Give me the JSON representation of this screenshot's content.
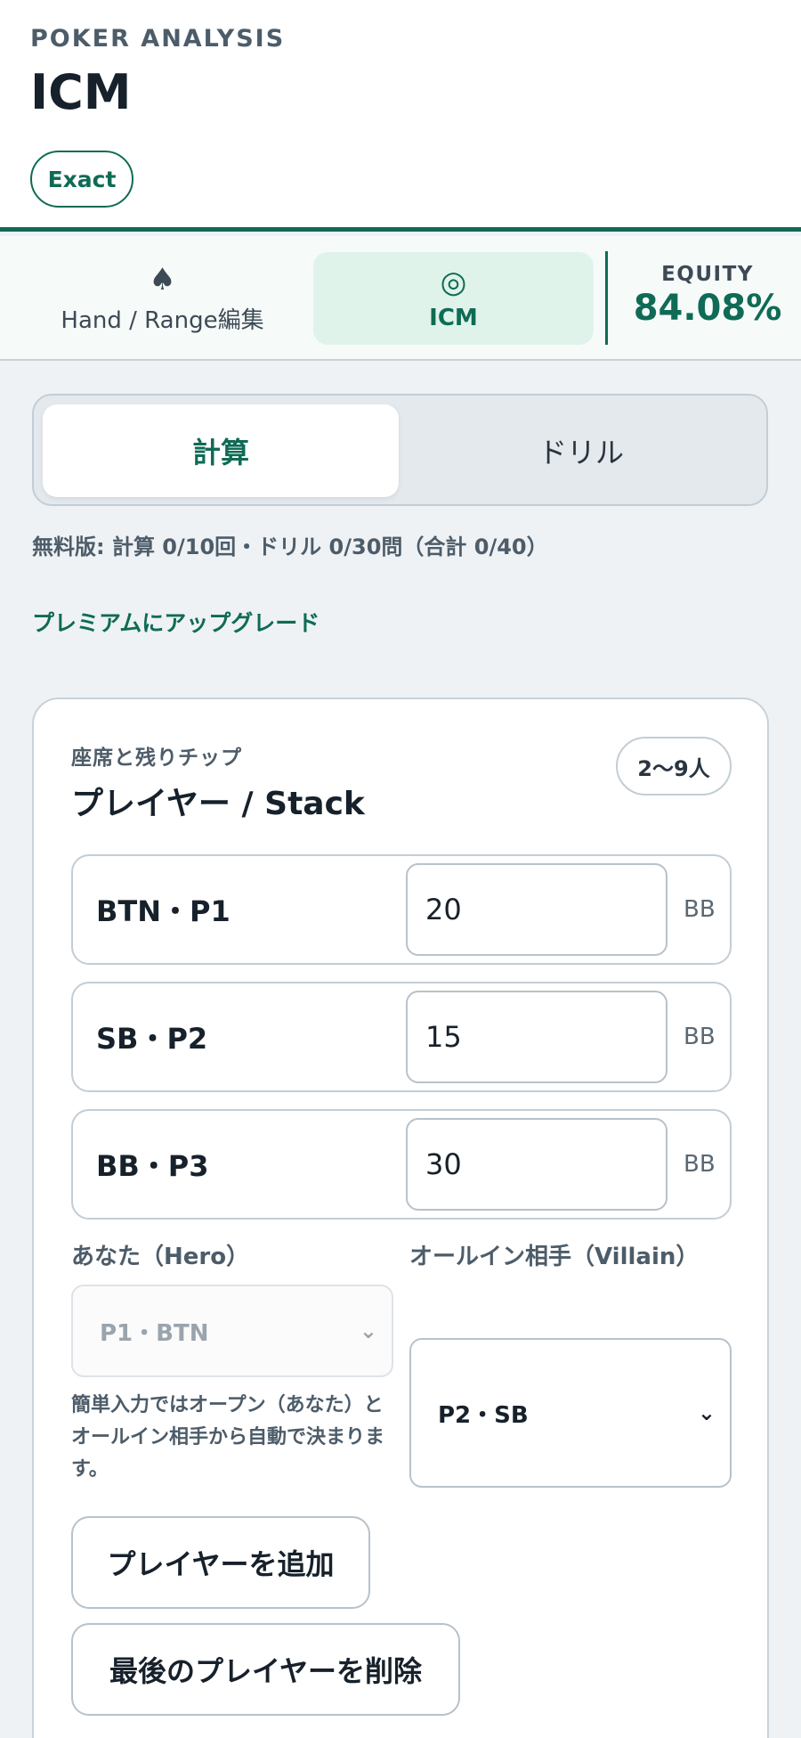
{
  "header": {
    "kicker": "POKER ANALYSIS",
    "title": "ICM",
    "badge": "Exact"
  },
  "tabs": [
    {
      "icon": "spade-icon",
      "glyph": "♠",
      "label": "Hand / Range編集",
      "active": false
    },
    {
      "icon": "target-icon",
      "glyph": "◎",
      "label": "ICM",
      "active": true
    }
  ],
  "equity": {
    "label": "EQUITY",
    "value": "84.08%"
  },
  "mode_switch": {
    "calc_label": "計算",
    "drill_label": "ドリル",
    "selected": "計算"
  },
  "free_note": "無料版: 計算 0/10回・ドリル 0/30問（合計 0/40）",
  "upgrade_link": "プレミアムにアップグレード",
  "players_card": {
    "subtitle": "座席と残りチップ",
    "title": "プレイヤー / Stack",
    "count_badge": "2〜9人",
    "rows": [
      {
        "name": "BTN・P1",
        "stack": "20",
        "unit": "BB"
      },
      {
        "name": "SB・P2",
        "stack": "15",
        "unit": "BB"
      },
      {
        "name": "BB・P3",
        "stack": "30",
        "unit": "BB"
      }
    ],
    "hero_label": "あなた（Hero）",
    "hero_value": "P1・BTN",
    "villain_label": "オールイン相手（Villain）",
    "villain_value": "P2・SB",
    "help_text": "簡単入力ではオープン（あなた）とオールイン相手から自動で決まります。",
    "add_button": "プレイヤーを追加",
    "remove_button": "最後のプレイヤーを削除"
  },
  "colors": {
    "accent": "#0f6b55",
    "accent_soft": "#dff3ea",
    "background": "#eef2f5"
  }
}
